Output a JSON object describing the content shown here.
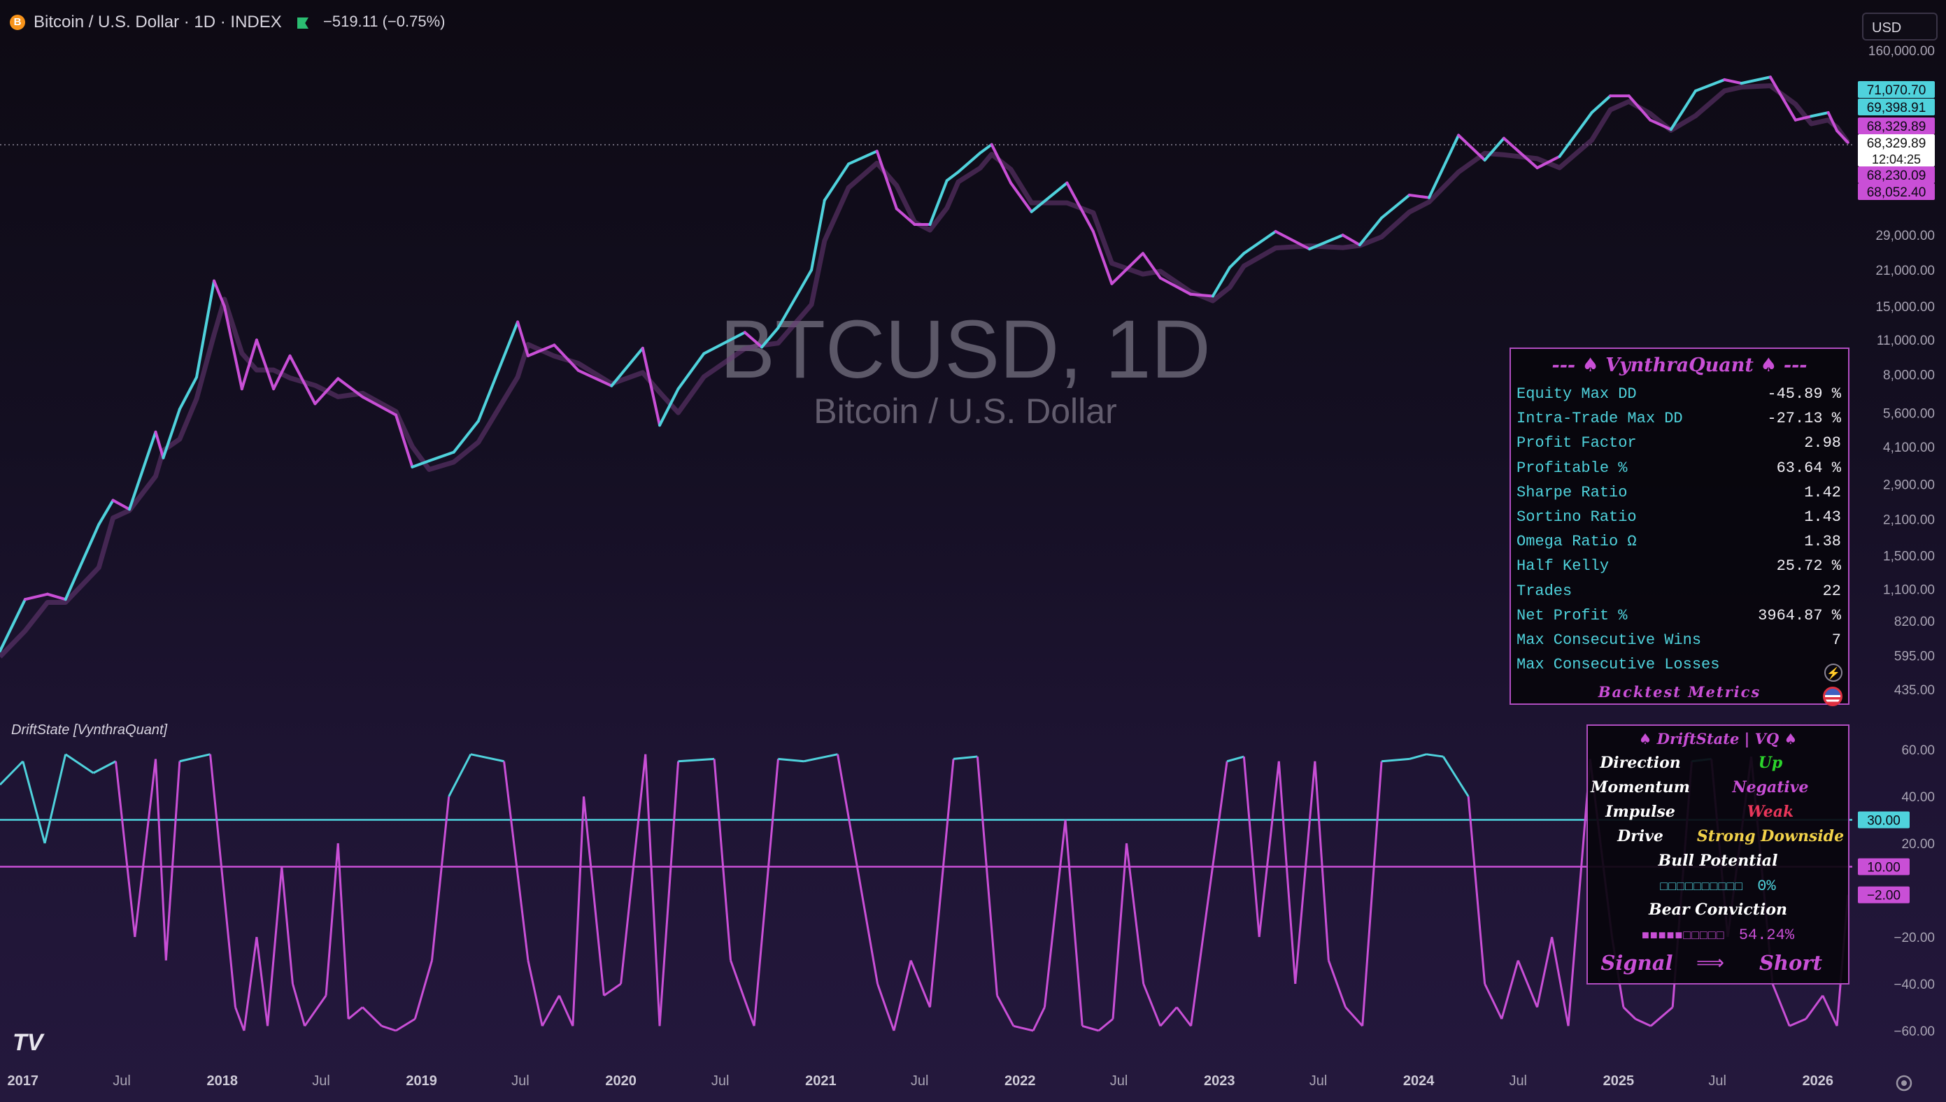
{
  "header": {
    "symbol_badge": "B",
    "title": "Bitcoin / U.S. Dollar · 1D · INDEX",
    "change": "−519.11 (−0.75%)",
    "currency_button": "USD"
  },
  "watermark": {
    "symbol": "BTCUSD, 1D",
    "name": "Bitcoin / U.S. Dollar"
  },
  "colors": {
    "bull": "#4fd2dc",
    "bear": "#c94fd6",
    "background": "#1e1433",
    "panel_border": "#b04dc0"
  },
  "chart_data": [
    {
      "type": "line",
      "title": "Bitcoin / U.S. Dollar",
      "y_scale": "log",
      "ylim": [
        435,
        160000
      ],
      "y_tick_labels": [
        "160,000.00",
        "29,000.00",
        "21,000.00",
        "15,000.00",
        "11,000.00",
        "8,000.00",
        "5,600.00",
        "4,100.00",
        "2,900.00",
        "2,100.00",
        "1,500.00",
        "1,100.00",
        "820.00",
        "595.00",
        "435.00"
      ],
      "x_tick_labels": [
        "2017",
        "Jul",
        "2018",
        "Jul",
        "2019",
        "Jul",
        "2020",
        "Jul",
        "2021",
        "Jul",
        "2022",
        "Jul",
        "2023",
        "Jul",
        "2024",
        "Jul",
        "2025",
        "Jul",
        "2026"
      ],
      "price_tags": [
        {
          "label": "71,070.70",
          "color": "#4fd2dc"
        },
        {
          "label": "69,398.91",
          "color": "#4fd2dc"
        },
        {
          "label": "68,329.89",
          "color": "#c94fd6"
        },
        {
          "label": "68,329.89",
          "sub": "12:04:25",
          "color": "#ffffff"
        },
        {
          "label": "68,230.09",
          "color": "#c94fd6"
        },
        {
          "label": "68,052.40",
          "color": "#c94fd6"
        }
      ],
      "series": [
        {
          "x": [
            "2016-11-20",
            "2017-01-05",
            "2017-02-15",
            "2017-03-20",
            "2017-05-20",
            "2017-06-15",
            "2017-07-15",
            "2017-09-01",
            "2017-09-15",
            "2017-10-15",
            "2017-11-15",
            "2017-12-17",
            "2018-01-05",
            "2018-02-06",
            "2018-03-05",
            "2018-04-05",
            "2018-05-05",
            "2018-06-20",
            "2018-08-01",
            "2018-09-15",
            "2018-11-15",
            "2018-12-15",
            "2019-01-15",
            "2019-03-01",
            "2019-04-15",
            "2019-06-26",
            "2019-07-15",
            "2019-09-01",
            "2019-10-15",
            "2019-12-15",
            "2020-02-10",
            "2020-03-12",
            "2020-04-15",
            "2020-06-01",
            "2020-08-15",
            "2020-09-15",
            "2020-10-15",
            "2020-12-15",
            "2021-01-08",
            "2021-02-21",
            "2021-04-14",
            "2021-05-20",
            "2021-06-22",
            "2021-07-20",
            "2021-08-20",
            "2021-09-10",
            "2021-10-20",
            "2021-11-10",
            "2021-12-15",
            "2022-01-22",
            "2022-03-28",
            "2022-05-15",
            "2022-06-18",
            "2022-08-14",
            "2022-09-15",
            "2022-11-09",
            "2022-12-20",
            "2023-01-20",
            "2023-02-15",
            "2023-04-14",
            "2023-06-15",
            "2023-08-15",
            "2023-09-15",
            "2023-10-25",
            "2023-12-15",
            "2024-01-20",
            "2024-03-14",
            "2024-05-01",
            "2024-06-05",
            "2024-08-05",
            "2024-09-15",
            "2024-11-13",
            "2024-12-17",
            "2025-01-20",
            "2025-02-28",
            "2025-04-07",
            "2025-05-22",
            "2025-07-14",
            "2025-08-14",
            "2025-10-06",
            "2025-11-21",
            "2025-12-20",
            "2026-01-20",
            "2026-02-05",
            "2026-02-25"
          ],
          "y": [
            620,
            1000,
            1050,
            1000,
            2000,
            2500,
            2300,
            4700,
            3700,
            5800,
            7800,
            19000,
            15000,
            7000,
            11000,
            7000,
            9500,
            6100,
            7700,
            6500,
            5500,
            3400,
            3600,
            3900,
            5200,
            13000,
            9500,
            10500,
            8300,
            7200,
            10200,
            5000,
            7000,
            9700,
            11800,
            10300,
            12300,
            21000,
            40000,
            56000,
            63000,
            37000,
            32000,
            32000,
            48000,
            52000,
            62000,
            67000,
            47000,
            36000,
            47000,
            30000,
            18500,
            24500,
            19500,
            16800,
            16500,
            21500,
            24500,
            30000,
            25500,
            29000,
            26500,
            34000,
            42000,
            41000,
            73000,
            58000,
            71000,
            54000,
            60000,
            90000,
            105000,
            105000,
            84000,
            77000,
            110000,
            122000,
            118000,
            125000,
            84000,
            87000,
            90000,
            76000,
            68300
          ],
          "trend": [
            "bull",
            "bull",
            "bear",
            "bear",
            "bull",
            "bull",
            "bear",
            "bull",
            "bear",
            "bull",
            "bull",
            "bull",
            "bear",
            "bear",
            "bear",
            "bear",
            "bear",
            "bear",
            "bear",
            "bear",
            "bear",
            "bear",
            "bull",
            "bull",
            "bull",
            "bull",
            "bear",
            "bear",
            "bear",
            "bear",
            "bull",
            "bear",
            "bull",
            "bull",
            "bull",
            "bear",
            "bull",
            "bull",
            "bull",
            "bull",
            "bull",
            "bear",
            "bear",
            "bear",
            "bull",
            "bull",
            "bull",
            "bull",
            "bear",
            "bear",
            "bull",
            "bear",
            "bear",
            "bear",
            "bear",
            "bear",
            "bear",
            "bull",
            "bull",
            "bull",
            "bear",
            "bull",
            "bear",
            "bull",
            "bull",
            "bear",
            "bull",
            "bear",
            "bull",
            "bear",
            "bear",
            "bull",
            "bull",
            "bear",
            "bear",
            "bear",
            "bull",
            "bull",
            "bear",
            "bull",
            "bear",
            "bear",
            "bull",
            "bear",
            "bear"
          ]
        }
      ]
    },
    {
      "type": "line",
      "title": "DriftState [VynthraQuant]",
      "ylim": [
        -65,
        65
      ],
      "y_tick_labels": [
        "60.00",
        "40.00",
        "20.00",
        "−20.00",
        "−40.00",
        "−60.00"
      ],
      "levels": [
        {
          "value": 30,
          "label": "30.00",
          "color": "#4fd2dc"
        },
        {
          "value": 10,
          "label": "10.00",
          "color": "#c94fd6"
        }
      ],
      "last_value": {
        "value": -2,
        "label": "−2.00"
      },
      "series": [
        {
          "x": [
            "2016-11-20",
            "2017-01-01",
            "2017-02-10",
            "2017-03-20",
            "2017-05-10",
            "2017-06-20",
            "2017-07-25",
            "2017-09-01",
            "2017-09-20",
            "2017-10-15",
            "2017-12-10",
            "2018-01-25",
            "2018-02-10",
            "2018-03-05",
            "2018-03-25",
            "2018-04-20",
            "2018-05-10",
            "2018-06-01",
            "2018-07-10",
            "2018-08-01",
            "2018-08-20",
            "2018-09-15",
            "2018-10-20",
            "2018-11-15",
            "2018-12-20",
            "2019-01-20",
            "2019-02-20",
            "2019-04-01",
            "2019-06-01",
            "2019-07-15",
            "2019-08-10",
            "2019-09-10",
            "2019-10-05",
            "2019-10-25",
            "2019-12-01",
            "2020-01-01",
            "2020-02-15",
            "2020-03-12",
            "2020-04-15",
            "2020-06-20",
            "2020-07-20",
            "2020-09-01",
            "2020-10-15",
            "2020-12-01",
            "2021-02-01",
            "2021-04-15",
            "2021-05-15",
            "2021-06-15",
            "2021-07-20",
            "2021-09-01",
            "2021-10-15",
            "2021-11-20",
            "2021-12-20",
            "2022-01-25",
            "2022-02-15",
            "2022-03-25",
            "2022-04-25",
            "2022-05-25",
            "2022-06-20",
            "2022-07-15",
            "2022-08-15",
            "2022-09-15",
            "2022-10-15",
            "2022-11-10",
            "2023-01-15",
            "2023-02-15",
            "2023-03-15",
            "2023-04-20",
            "2023-05-20",
            "2023-06-25",
            "2023-07-20",
            "2023-08-20",
            "2023-09-20",
            "2023-10-25",
            "2023-12-15",
            "2024-01-15",
            "2024-02-15",
            "2024-04-01",
            "2024-05-01",
            "2024-06-01",
            "2024-07-01",
            "2024-08-05",
            "2024-09-01",
            "2024-10-01",
            "2024-11-10",
            "2024-12-20",
            "2025-01-10",
            "2025-02-01",
            "2025-03-01",
            "2025-04-10",
            "2025-05-15",
            "2025-06-20",
            "2025-07-20",
            "2025-09-01",
            "2025-10-10",
            "2025-11-10",
            "2025-12-10",
            "2026-01-10",
            "2026-02-05",
            "2026-02-25"
          ],
          "y": [
            45,
            55,
            20,
            58,
            50,
            55,
            -20,
            56,
            -30,
            55,
            58,
            -50,
            -60,
            -20,
            -58,
            10,
            -40,
            -58,
            -45,
            20,
            -55,
            -50,
            -58,
            -60,
            -55,
            -30,
            40,
            58,
            55,
            -30,
            -58,
            -45,
            -58,
            40,
            -45,
            -40,
            58,
            -58,
            55,
            56,
            -30,
            -58,
            56,
            55,
            58,
            -40,
            -60,
            -30,
            -50,
            56,
            57,
            -45,
            -58,
            -60,
            -50,
            30,
            -58,
            -60,
            -55,
            20,
            -40,
            -58,
            -50,
            -58,
            55,
            57,
            -20,
            55,
            -40,
            55,
            -30,
            -50,
            -58,
            55,
            56,
            58,
            57,
            40,
            -40,
            -55,
            -30,
            -50,
            -20,
            -58,
            56,
            -20,
            -50,
            -55,
            -58,
            -50,
            55,
            56,
            -20,
            57,
            -40,
            -58,
            -55,
            -45,
            -58,
            -2
          ]
        }
      ]
    }
  ],
  "indicator": {
    "title": "DriftState [VynthraQuant]",
    "logo": "TV"
  },
  "metrics_panel": {
    "title": "--- ♠ VynthraQuant ♠ ---",
    "footer": "Backtest Metrics",
    "rows": [
      {
        "label": "Equity Max DD",
        "value": "-45.89 %"
      },
      {
        "label": "Intra-Trade Max DD",
        "value": "-27.13 %"
      },
      {
        "label": "Profit Factor",
        "value": "2.98"
      },
      {
        "label": "Profitable %",
        "value": "63.64 %"
      },
      {
        "label": "Sharpe Ratio",
        "value": "1.42"
      },
      {
        "label": "Sortino Ratio",
        "value": "1.43"
      },
      {
        "label": "Omega Ratio Ω",
        "value": "1.38"
      },
      {
        "label": "Half Kelly",
        "value": "25.72 %"
      },
      {
        "label": "Trades",
        "value": "22"
      },
      {
        "label": "Net Profit %",
        "value": "3964.87 %"
      },
      {
        "label": "Max Consecutive Wins",
        "value": "7"
      },
      {
        "label": "Max Consecutive Losses",
        "value": ""
      }
    ]
  },
  "drift_panel": {
    "title": "♠ DriftState | VQ ♠",
    "direction": {
      "label": "Direction",
      "value": "Up"
    },
    "momentum": {
      "label": "Momentum",
      "value": "Negative"
    },
    "impulse": {
      "label": "Impulse",
      "value": "Weak"
    },
    "drive": {
      "label": "Drive",
      "value": "Strong Downside"
    },
    "bull_potential": {
      "label": "Bull Potential",
      "bar": "□□□□□□□□□□",
      "value": "0%",
      "fraction": 0.0
    },
    "bear_conviction": {
      "label": "Bear Conviction",
      "bar": "■■■■■□□□□□",
      "value": "54.24%",
      "fraction": 0.5424
    },
    "signal": {
      "label": "Signal",
      "arrow": "⟹",
      "value": "Short"
    }
  }
}
